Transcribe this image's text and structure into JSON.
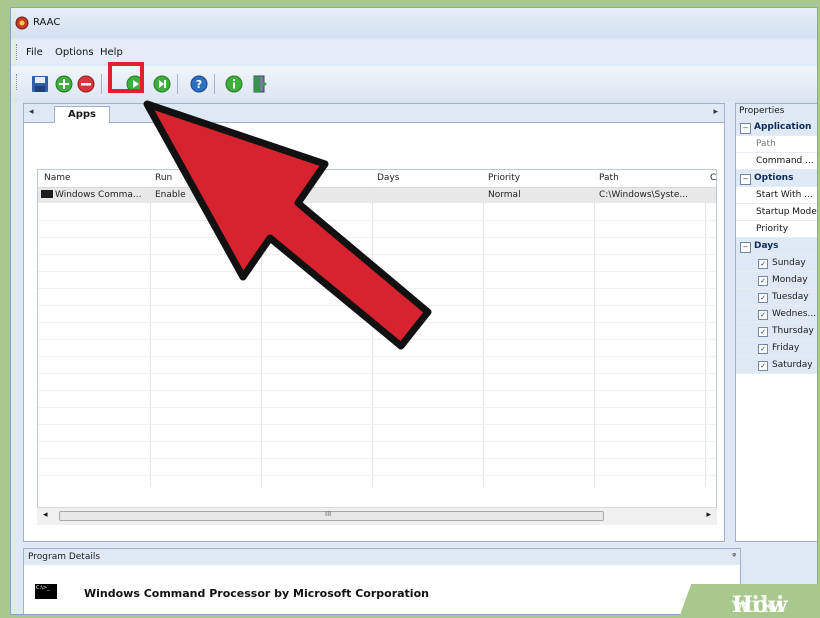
{
  "window": {
    "title": "RAAC",
    "menu": [
      "File",
      "Options",
      "Help"
    ]
  },
  "toolbar": {
    "buttons": [
      "save-icon",
      "add-icon",
      "remove-icon",
      "start-icon",
      "forward-icon",
      "help-icon",
      "info-icon",
      "exit-icon"
    ],
    "highlighted": "start-icon"
  },
  "tabs": {
    "left_arrow": "◂",
    "right_arrow": "▸",
    "active": "Apps"
  },
  "grid": {
    "columns": [
      "Name",
      "Run",
      "Days",
      "Priority",
      "Path",
      "C"
    ],
    "rows": [
      {
        "name": "Windows Comma...",
        "run": "Enable",
        "days": "",
        "priority": "Normal",
        "path": "C:\\Windows\\Syste..."
      }
    ],
    "scroll_left": "◂",
    "scroll_right": "▸",
    "scroll_grip": "III"
  },
  "properties": {
    "title": "Properties",
    "sections": [
      {
        "label": "Application",
        "toggle": "−",
        "items": [
          "Path",
          "Command ..."
        ]
      },
      {
        "label": "Options",
        "toggle": "−",
        "items": [
          "Start With ...",
          "Startup Mode",
          "Priority"
        ]
      },
      {
        "label": "Days",
        "toggle": "−",
        "items": [
          "Sunday",
          "Monday",
          "Tuesday",
          "Wednes...",
          "Thursday",
          "Friday",
          "Saturday"
        ]
      }
    ]
  },
  "details": {
    "title": "Program Details",
    "pin": "ᵠ",
    "icon_text": "C:\\>_",
    "text": "Windows Command Processor by Microsoft Corporation"
  },
  "watermark": {
    "wiki": "wiki",
    "how": "How"
  },
  "colors": {
    "arrow": "#d6232f",
    "arrow_outline": "#111111",
    "highlight": "#e0202c",
    "frame": "#a8c88e"
  }
}
